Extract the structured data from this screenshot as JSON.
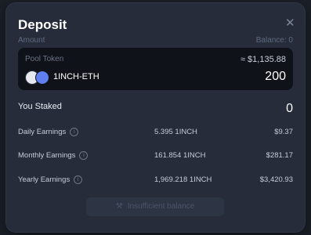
{
  "modal": {
    "title": "Deposit",
    "close_icon": "close-icon"
  },
  "amount": {
    "label": "Amount",
    "balance": "Balance: 0"
  },
  "input": {
    "pool_token_label": "Pool Token",
    "usd_value": "≈ $1,135.88",
    "token_name": "1INCH-ETH",
    "value": "200",
    "token_icons": [
      "1inch-token-icon",
      "eth-token-icon"
    ]
  },
  "staked": {
    "label": "You Staked",
    "value": "0"
  },
  "earnings": [
    {
      "label": "Daily Earnings",
      "amount": "5.395 1INCH",
      "usd": "$9.37"
    },
    {
      "label": "Monthly Earnings",
      "amount": "161.854 1INCH",
      "usd": "$281.17"
    },
    {
      "label": "Yearly Earnings",
      "amount": "1,969.218 1INCH",
      "usd": "$3,420.93"
    }
  ],
  "submit": {
    "label": "Insufficient balance",
    "icon": "magic-wand-icon"
  },
  "colors": {
    "background": "#1a1f28",
    "modal": "#262c39",
    "input_bg": "#0f1218",
    "button_disabled": "#2d3444"
  }
}
